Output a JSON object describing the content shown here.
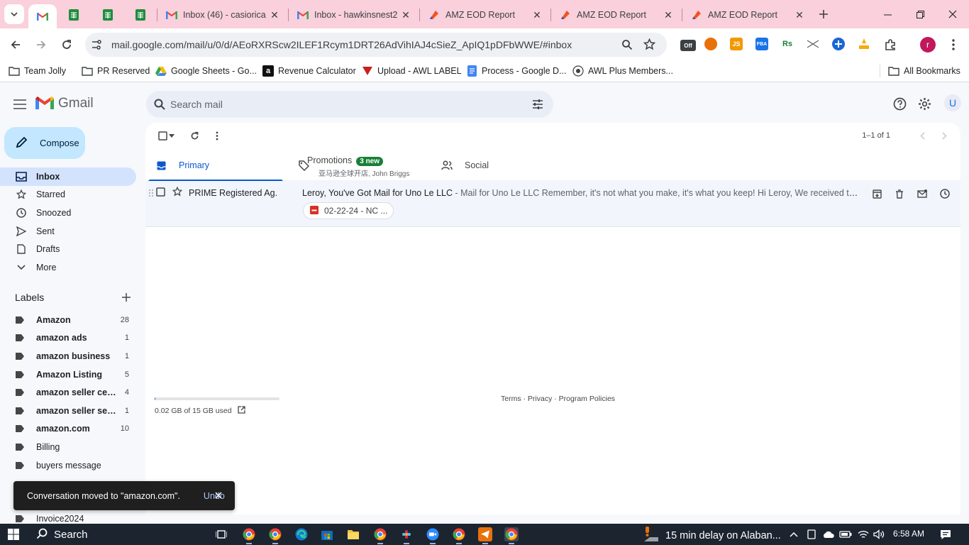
{
  "browser": {
    "tabs": [
      {
        "title": "",
        "favicon": "gmail-icon",
        "active": true
      },
      {
        "title": "",
        "favicon": "google-sheets-icon"
      },
      {
        "title": "",
        "favicon": "google-sheets-icon"
      },
      {
        "title": "",
        "favicon": "google-sheets-icon"
      },
      {
        "title": "Inbox (46) - casiorica",
        "favicon": "gmail-icon"
      },
      {
        "title": "Inbox - hawkinsnest2",
        "favicon": "gmail-icon"
      },
      {
        "title": "AMZ EOD Report",
        "favicon": "report-icon"
      },
      {
        "title": "AMZ EOD Report",
        "favicon": "report-icon"
      },
      {
        "title": "AMZ EOD Report",
        "favicon": "report-icon"
      }
    ],
    "url": "mail.google.com/mail/u/0/d/AEoRXRScw2ILEF1Rcym1DRT26AdVihIAJ4cSieZ_ApIQ1pDFbWWE/#inbox",
    "url_domain": "mail.google.com",
    "extension_off_label": "Off",
    "extension_js_label": "JS",
    "extension_fba_label": "FBA",
    "extension_rs_label": "Rs",
    "profile_initial": "r",
    "bookmarks": [
      {
        "label": "Team Jolly",
        "icon": "folder-icon"
      },
      {
        "label": "PR Reserved",
        "icon": "folder-icon"
      },
      {
        "label": "Google Sheets - Go...",
        "icon": "google-drive-icon"
      },
      {
        "label": "Revenue Calculator",
        "icon": "amazon-icon"
      },
      {
        "label": "Upload - AWL LABEL",
        "icon": "awl-icon"
      },
      {
        "label": "Process - Google D...",
        "icon": "google-docs-icon"
      },
      {
        "label": "AWL Plus Members...",
        "icon": "awl-plus-icon"
      }
    ],
    "all_bookmarks_label": "All Bookmarks"
  },
  "gmail": {
    "logo_text": "Gmail",
    "search_placeholder": "Search mail",
    "avatar_initial": "U",
    "compose_label": "Compose",
    "nav": [
      {
        "label": "Inbox",
        "icon": "inbox-icon",
        "active": true
      },
      {
        "label": "Starred",
        "icon": "star-icon"
      },
      {
        "label": "Snoozed",
        "icon": "clock-icon"
      },
      {
        "label": "Sent",
        "icon": "send-icon"
      },
      {
        "label": "Drafts",
        "icon": "draft-icon"
      },
      {
        "label": "More",
        "icon": "chevron-down-icon"
      }
    ],
    "labels_heading": "Labels",
    "labels": [
      {
        "name": "Amazon",
        "count": "28",
        "bold": true
      },
      {
        "name": "amazon ads",
        "count": "1",
        "bold": true
      },
      {
        "name": "amazon business",
        "count": "1",
        "bold": true
      },
      {
        "name": "Amazon Listing",
        "count": "5",
        "bold": true
      },
      {
        "name": "amazon seller cent...",
        "count": "4",
        "bold": true
      },
      {
        "name": "amazon seller servi...",
        "count": "1",
        "bold": true
      },
      {
        "name": "amazon.com",
        "count": "10",
        "bold": true
      },
      {
        "name": "Billing",
        "count": "",
        "bold": false
      },
      {
        "name": "buyers message",
        "count": "",
        "bold": false
      },
      {
        "name": "Invoice2024",
        "count": "",
        "bold": false
      }
    ],
    "pager": "1–1 of 1",
    "category_tabs": {
      "primary": "Primary",
      "promotions": "Promotions",
      "promotions_badge": "3 new",
      "promotions_sub": "亚马逊全球开店, John Briggs",
      "social": "Social"
    },
    "mail": {
      "sender": "PRIME Registered Ag.",
      "subject": "Leroy, You've Got Mail for Uno Le LLC",
      "snippet": " - Mail for Uno Le LLC Remember, it's not what you make, it's what you keep! Hi Leroy, We received the attached piec...",
      "attachment": "02-22-24 - NC ..."
    },
    "storage": {
      "text": "0.02 GB of 15 GB used",
      "fraction": 0.0013
    },
    "footer": "Terms · Privacy · Program Policies",
    "toast": {
      "message": "Conversation moved to \"amazon.com\".",
      "action": "Undo"
    }
  },
  "taskbar": {
    "search_label": "Search",
    "news": "15 min delay on Alaban...",
    "time": "6:58 AM"
  },
  "colors": {
    "tab_strip": "#f9d0dc",
    "compose": "#c2e7ff",
    "active_nav": "#d3e3fd",
    "accent": "#0b57d0"
  }
}
